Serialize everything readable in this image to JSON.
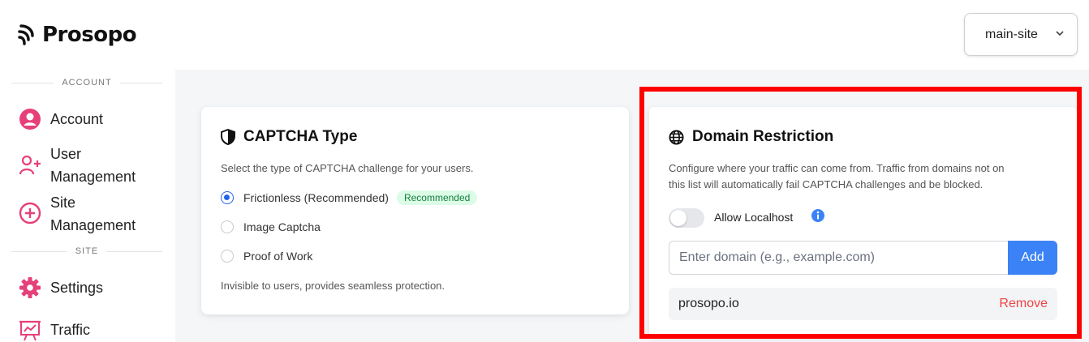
{
  "brand": {
    "name": "Prosopo"
  },
  "site_selector": {
    "value": "main-site",
    "icon": "chevron-down-icon"
  },
  "sidebar": {
    "sections": {
      "account": "ACCOUNT",
      "site": "SITE"
    },
    "items": [
      {
        "label": "Account",
        "icon": "user-circle-icon"
      },
      {
        "label": "User Management",
        "line1": "User",
        "line2": "Management",
        "icon": "user-add-icon"
      },
      {
        "label": "Site Management",
        "line1": "Site",
        "line2": "Management",
        "icon": "plus-circle-icon"
      },
      {
        "label": "Settings",
        "icon": "gear-icon"
      },
      {
        "label": "Traffic",
        "icon": "chart-board-icon"
      }
    ]
  },
  "captcha_card": {
    "title": "CAPTCHA Type",
    "icon": "shield-icon",
    "description": "Select the type of CAPTCHA challenge for your users.",
    "options": [
      {
        "label": "Frictionless (Recommended)",
        "checked": true,
        "badge": "Recommended"
      },
      {
        "label": "Image Captcha",
        "checked": false
      },
      {
        "label": "Proof of Work",
        "checked": false
      }
    ],
    "footer": "Invisible to users, provides seamless protection."
  },
  "domain_card": {
    "title": "Domain Restriction",
    "icon": "globe-icon",
    "description_line1": "Configure where your traffic can come from. Traffic from domains not on",
    "description_line2": "this list will automatically fail CAPTCHA challenges and be blocked.",
    "toggle_label": "Allow Localhost",
    "toggle_on": false,
    "input_placeholder": "Enter domain (e.g., example.com)",
    "add_label": "Add",
    "domains": [
      {
        "name": "prosopo.io",
        "action": "Remove"
      }
    ]
  },
  "colors": {
    "accent": "#3b82f6",
    "sidebar_icon": "#e6407a",
    "highlight": "#ff0000",
    "remove": "#ef4444"
  }
}
